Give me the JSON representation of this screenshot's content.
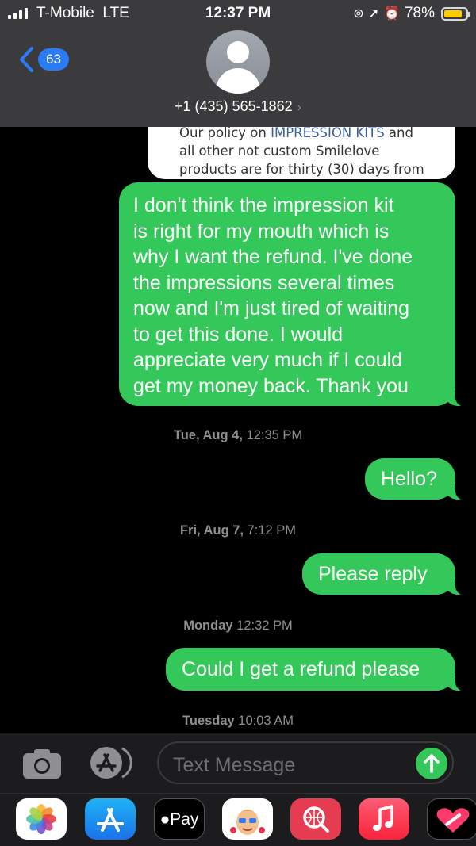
{
  "status_bar": {
    "carrier": "T-Mobile",
    "network": "LTE",
    "time": "12:37 PM",
    "battery": "78%",
    "battery_level": 0.78
  },
  "header": {
    "back_count": "63",
    "contact": "+1 (435) 565-1862",
    "contact_chevron": "›"
  },
  "card": {
    "line1_a": "Our policy on ",
    "line1_kits": "IMPRESSION KITS",
    "line1_b": " and",
    "line2": "all other not custom Smilelove",
    "line3": "products are for thirty (30) days from"
  },
  "messages": [
    {
      "lines": [
        "I don't think the impression kit",
        "is right for my mouth which is",
        "why I want the refund. I've done",
        "the impressions several times",
        "now and I'm just tired of waiting",
        "to get this done. I would",
        "appreciate very much if I could",
        "get my money back. Thank you"
      ]
    },
    {
      "text": "Hello?"
    },
    {
      "text": "Please reply"
    },
    {
      "text": "Could I get a refund please"
    }
  ],
  "timestamps": [
    {
      "day": "Tue, Aug 4,",
      "time": "12:35 PM"
    },
    {
      "day": "Fri, Aug 7,",
      "time": "7:12 PM"
    },
    {
      "day": "Monday",
      "time": "12:32 PM"
    },
    {
      "day": "Tuesday",
      "time": "10:03 AM"
    }
  ],
  "input": {
    "placeholder": "Text Message"
  },
  "drawer": {
    "pay_label": "Pay",
    "apps": [
      "photos-icon",
      "app-store-icon",
      "apple-pay-icon",
      "memoji-icon",
      "web-search-icon",
      "music-icon",
      "digital-touch-icon"
    ]
  },
  "colors": {
    "bubble": "#34c759",
    "badge": "#2a7bf6",
    "header": "#3b3b3d",
    "battery": "#ffcc00"
  }
}
